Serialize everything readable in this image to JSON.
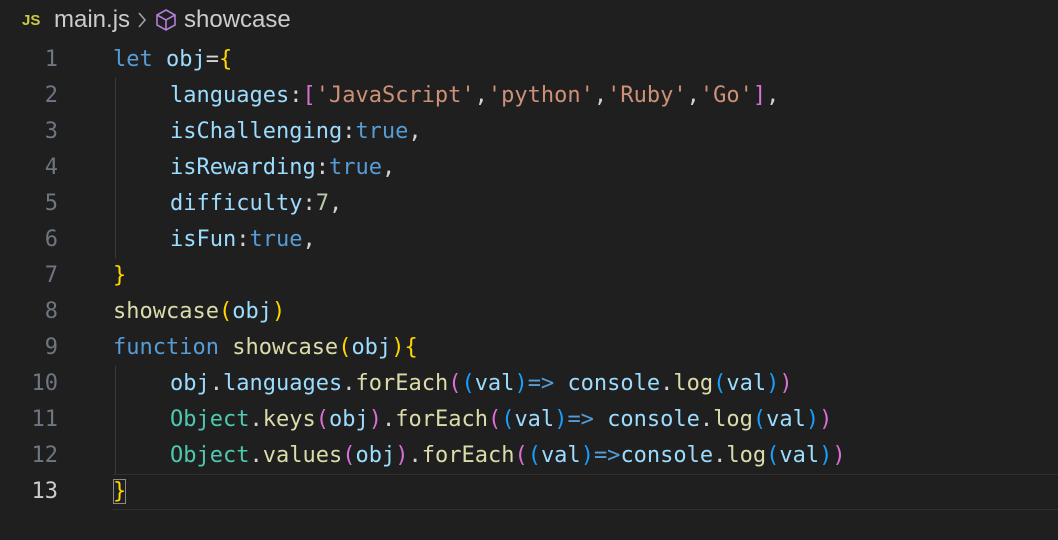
{
  "breadcrumb": {
    "file_icon": "JS",
    "file": "main.js",
    "separator": "chevron-right-icon",
    "symbol_icon": "cube-icon",
    "symbol": "showcase"
  },
  "editor": {
    "current_line": 13,
    "lines": [
      {
        "num": "1",
        "indent": 0,
        "tokens": [
          {
            "t": "let",
            "c": "kw"
          },
          {
            "t": " ",
            "c": "op"
          },
          {
            "t": "obj",
            "c": "var"
          },
          {
            "t": "=",
            "c": "op"
          },
          {
            "t": "{",
            "c": "b1"
          }
        ]
      },
      {
        "num": "2",
        "indent": 1,
        "tokens": [
          {
            "t": "languages",
            "c": "prop"
          },
          {
            "t": ":",
            "c": "op"
          },
          {
            "t": "[",
            "c": "b2"
          },
          {
            "t": "'JavaScript'",
            "c": "str"
          },
          {
            "t": ",",
            "c": "op"
          },
          {
            "t": "'python'",
            "c": "str"
          },
          {
            "t": ",",
            "c": "op"
          },
          {
            "t": "'Ruby'",
            "c": "str"
          },
          {
            "t": ",",
            "c": "op"
          },
          {
            "t": "'Go'",
            "c": "str"
          },
          {
            "t": "]",
            "c": "b2"
          },
          {
            "t": ",",
            "c": "op"
          }
        ]
      },
      {
        "num": "3",
        "indent": 1,
        "tokens": [
          {
            "t": "isChallenging",
            "c": "prop"
          },
          {
            "t": ":",
            "c": "op"
          },
          {
            "t": "true",
            "c": "bool"
          },
          {
            "t": ",",
            "c": "op"
          }
        ]
      },
      {
        "num": "4",
        "indent": 1,
        "tokens": [
          {
            "t": "isRewarding",
            "c": "prop"
          },
          {
            "t": ":",
            "c": "op"
          },
          {
            "t": "true",
            "c": "bool"
          },
          {
            "t": ",",
            "c": "op"
          }
        ]
      },
      {
        "num": "5",
        "indent": 1,
        "tokens": [
          {
            "t": "difficulty",
            "c": "prop"
          },
          {
            "t": ":",
            "c": "op"
          },
          {
            "t": "7",
            "c": "num"
          },
          {
            "t": ",",
            "c": "op"
          }
        ]
      },
      {
        "num": "6",
        "indent": 1,
        "tokens": [
          {
            "t": "isFun",
            "c": "prop"
          },
          {
            "t": ":",
            "c": "op"
          },
          {
            "t": "true",
            "c": "bool"
          },
          {
            "t": ",",
            "c": "op"
          }
        ]
      },
      {
        "num": "7",
        "indent": 0,
        "tokens": [
          {
            "t": "}",
            "c": "b1"
          }
        ]
      },
      {
        "num": "8",
        "indent": 0,
        "tokens": [
          {
            "t": "showcase",
            "c": "fn"
          },
          {
            "t": "(",
            "c": "b1"
          },
          {
            "t": "obj",
            "c": "var"
          },
          {
            "t": ")",
            "c": "b1"
          }
        ]
      },
      {
        "num": "9",
        "indent": 0,
        "tokens": [
          {
            "t": "function",
            "c": "kw"
          },
          {
            "t": " ",
            "c": "op"
          },
          {
            "t": "showcase",
            "c": "fn"
          },
          {
            "t": "(",
            "c": "b1"
          },
          {
            "t": "obj",
            "c": "var"
          },
          {
            "t": ")",
            "c": "b1"
          },
          {
            "t": "{",
            "c": "b1"
          }
        ]
      },
      {
        "num": "10",
        "indent": 1,
        "tokens": [
          {
            "t": "obj",
            "c": "var"
          },
          {
            "t": ".",
            "c": "op"
          },
          {
            "t": "languages",
            "c": "prop"
          },
          {
            "t": ".",
            "c": "op"
          },
          {
            "t": "forEach",
            "c": "fn"
          },
          {
            "t": "(",
            "c": "b2"
          },
          {
            "t": "(",
            "c": "b3"
          },
          {
            "t": "val",
            "c": "var"
          },
          {
            "t": ")",
            "c": "b3"
          },
          {
            "t": "=>",
            "c": "kw"
          },
          {
            "t": " ",
            "c": "op"
          },
          {
            "t": "console",
            "c": "var"
          },
          {
            "t": ".",
            "c": "op"
          },
          {
            "t": "log",
            "c": "fn"
          },
          {
            "t": "(",
            "c": "b3"
          },
          {
            "t": "val",
            "c": "var"
          },
          {
            "t": ")",
            "c": "b3"
          },
          {
            "t": ")",
            "c": "b2"
          }
        ]
      },
      {
        "num": "11",
        "indent": 1,
        "tokens": [
          {
            "t": "Object",
            "c": "cls"
          },
          {
            "t": ".",
            "c": "op"
          },
          {
            "t": "keys",
            "c": "fn"
          },
          {
            "t": "(",
            "c": "b2"
          },
          {
            "t": "obj",
            "c": "var"
          },
          {
            "t": ")",
            "c": "b2"
          },
          {
            "t": ".",
            "c": "op"
          },
          {
            "t": "forEach",
            "c": "fn"
          },
          {
            "t": "(",
            "c": "b2"
          },
          {
            "t": "(",
            "c": "b3"
          },
          {
            "t": "val",
            "c": "var"
          },
          {
            "t": ")",
            "c": "b3"
          },
          {
            "t": "=>",
            "c": "kw"
          },
          {
            "t": " ",
            "c": "op"
          },
          {
            "t": "console",
            "c": "var"
          },
          {
            "t": ".",
            "c": "op"
          },
          {
            "t": "log",
            "c": "fn"
          },
          {
            "t": "(",
            "c": "b3"
          },
          {
            "t": "val",
            "c": "var"
          },
          {
            "t": ")",
            "c": "b3"
          },
          {
            "t": ")",
            "c": "b2"
          }
        ]
      },
      {
        "num": "12",
        "indent": 1,
        "tokens": [
          {
            "t": "Object",
            "c": "cls"
          },
          {
            "t": ".",
            "c": "op"
          },
          {
            "t": "values",
            "c": "fn"
          },
          {
            "t": "(",
            "c": "b2"
          },
          {
            "t": "obj",
            "c": "var"
          },
          {
            "t": ")",
            "c": "b2"
          },
          {
            "t": ".",
            "c": "op"
          },
          {
            "t": "forEach",
            "c": "fn"
          },
          {
            "t": "(",
            "c": "b2"
          },
          {
            "t": "(",
            "c": "b3"
          },
          {
            "t": "val",
            "c": "var"
          },
          {
            "t": ")",
            "c": "b3"
          },
          {
            "t": "=>",
            "c": "kw"
          },
          {
            "t": "console",
            "c": "var"
          },
          {
            "t": ".",
            "c": "op"
          },
          {
            "t": "log",
            "c": "fn"
          },
          {
            "t": "(",
            "c": "b3"
          },
          {
            "t": "val",
            "c": "var"
          },
          {
            "t": ")",
            "c": "b3"
          },
          {
            "t": ")",
            "c": "b2"
          }
        ]
      },
      {
        "num": "13",
        "indent": 0,
        "tokens": [
          {
            "t": "}",
            "c": "b1",
            "cursor": true
          }
        ]
      }
    ]
  }
}
